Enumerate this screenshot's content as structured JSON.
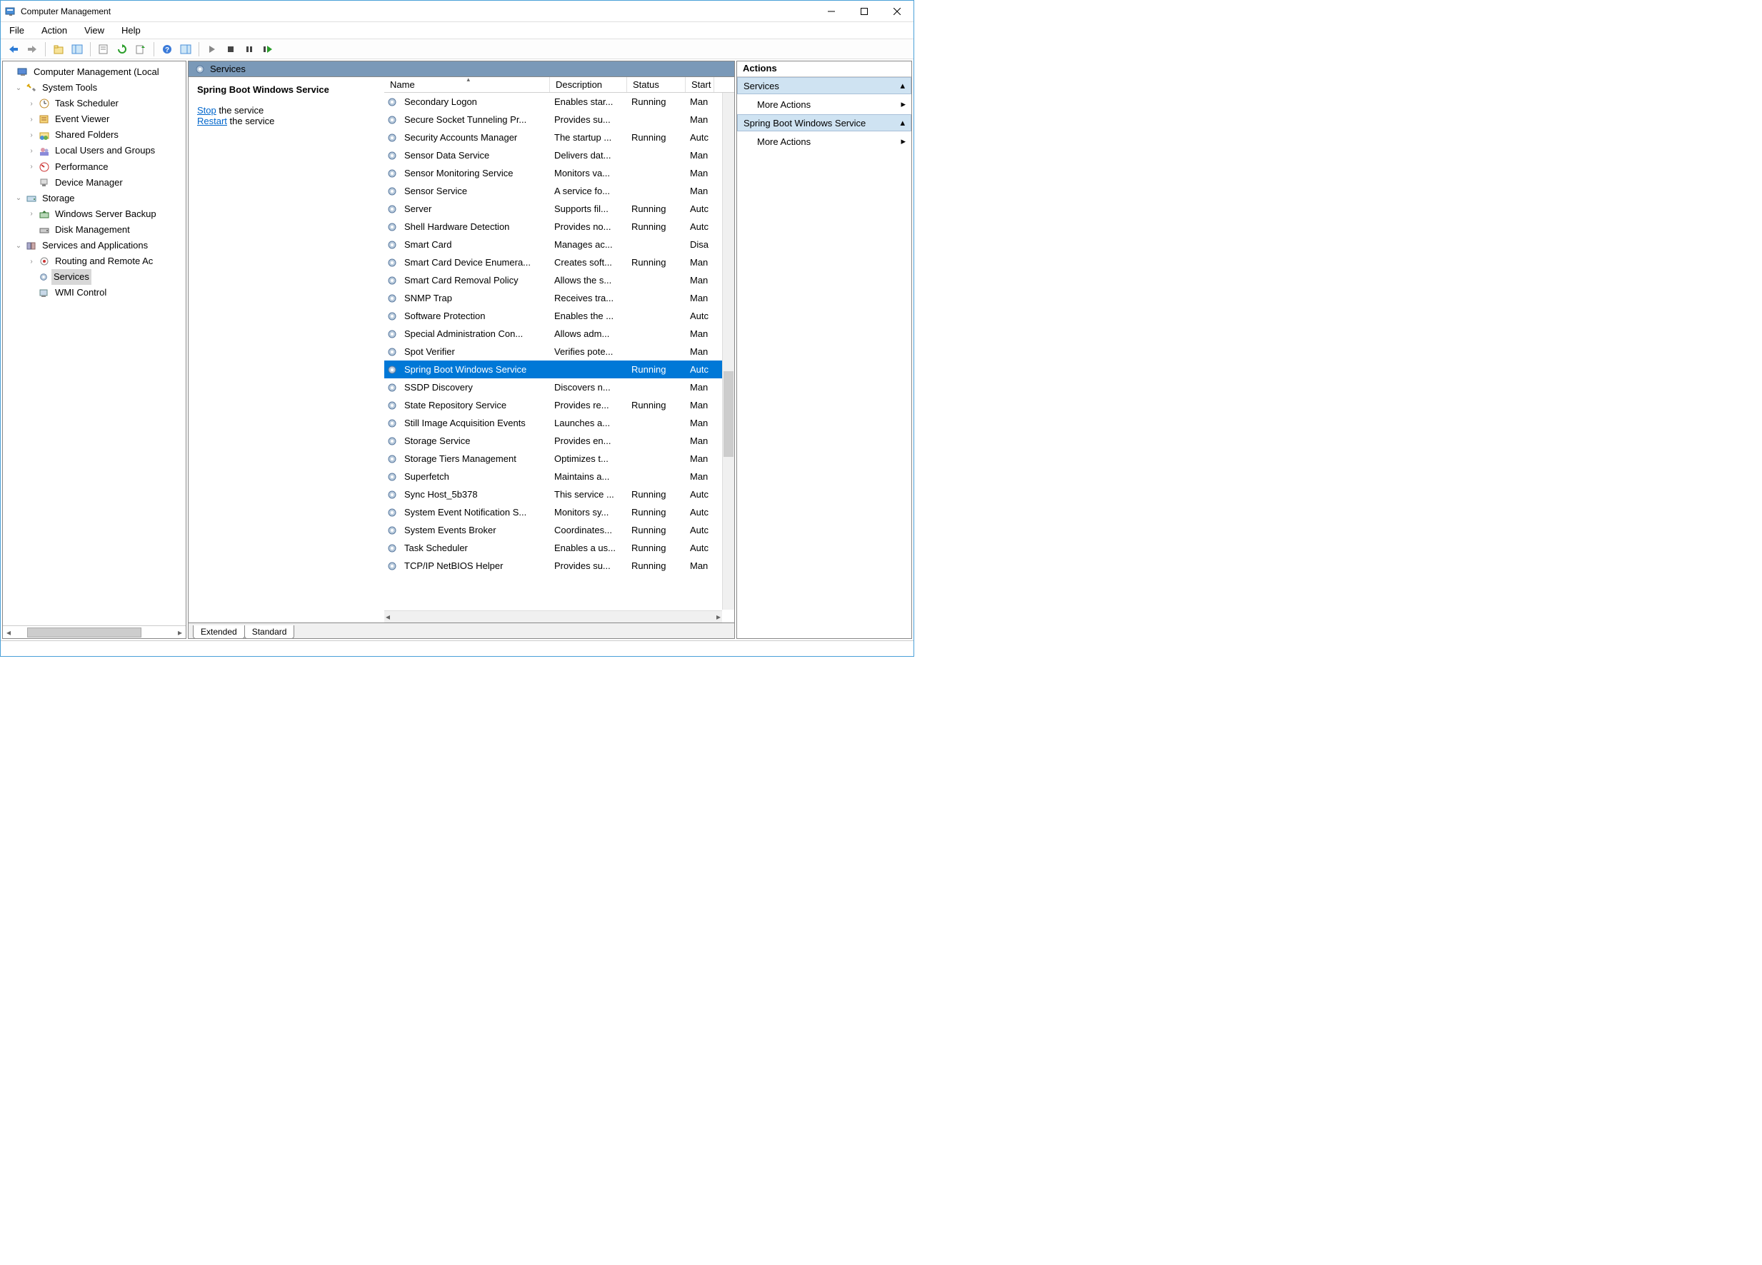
{
  "window": {
    "title": "Computer Management"
  },
  "menus": {
    "file": "File",
    "action": "Action",
    "view": "View",
    "help": "Help"
  },
  "tree": {
    "root": "Computer Management (Local",
    "systemTools": "System Tools",
    "taskScheduler": "Task Scheduler",
    "eventViewer": "Event Viewer",
    "sharedFolders": "Shared Folders",
    "localUsers": "Local Users and Groups",
    "performance": "Performance",
    "deviceManager": "Device Manager",
    "storage": "Storage",
    "wsb": "Windows Server Backup",
    "diskMgmt": "Disk Management",
    "servicesApps": "Services and Applications",
    "rras": "Routing and Remote Ac",
    "services": "Services",
    "wmi": "WMI Control"
  },
  "servicesHeader": "Services",
  "selectedService": "Spring Boot Windows Service",
  "controls": {
    "stop": "Stop",
    "restart": "Restart",
    "theService": " the service"
  },
  "columns": {
    "name": "Name",
    "desc": "Description",
    "status": "Status",
    "startup": "Start"
  },
  "tabs": {
    "extended": "Extended",
    "standard": "Standard"
  },
  "actions": {
    "header": "Actions",
    "services": "Services",
    "more": "More Actions",
    "selected": "Spring Boot Windows Service"
  },
  "rows": [
    {
      "name": "Secondary Logon",
      "desc": "Enables star...",
      "status": "Running",
      "start": "Man"
    },
    {
      "name": "Secure Socket Tunneling Pr...",
      "desc": "Provides su...",
      "status": "",
      "start": "Man"
    },
    {
      "name": "Security Accounts Manager",
      "desc": "The startup ...",
      "status": "Running",
      "start": "Autc"
    },
    {
      "name": "Sensor Data Service",
      "desc": "Delivers dat...",
      "status": "",
      "start": "Man"
    },
    {
      "name": "Sensor Monitoring Service",
      "desc": "Monitors va...",
      "status": "",
      "start": "Man"
    },
    {
      "name": "Sensor Service",
      "desc": "A service fo...",
      "status": "",
      "start": "Man"
    },
    {
      "name": "Server",
      "desc": "Supports fil...",
      "status": "Running",
      "start": "Autc"
    },
    {
      "name": "Shell Hardware Detection",
      "desc": "Provides no...",
      "status": "Running",
      "start": "Autc"
    },
    {
      "name": "Smart Card",
      "desc": "Manages ac...",
      "status": "",
      "start": "Disa"
    },
    {
      "name": "Smart Card Device Enumera...",
      "desc": "Creates soft...",
      "status": "Running",
      "start": "Man"
    },
    {
      "name": "Smart Card Removal Policy",
      "desc": "Allows the s...",
      "status": "",
      "start": "Man"
    },
    {
      "name": "SNMP Trap",
      "desc": "Receives tra...",
      "status": "",
      "start": "Man"
    },
    {
      "name": "Software Protection",
      "desc": "Enables the ...",
      "status": "",
      "start": "Autc"
    },
    {
      "name": "Special Administration Con...",
      "desc": "Allows adm...",
      "status": "",
      "start": "Man"
    },
    {
      "name": "Spot Verifier",
      "desc": "Verifies pote...",
      "status": "",
      "start": "Man"
    },
    {
      "name": "Spring Boot Windows Service",
      "desc": "",
      "status": "Running",
      "start": "Autc",
      "selected": true
    },
    {
      "name": "SSDP Discovery",
      "desc": "Discovers n...",
      "status": "",
      "start": "Man"
    },
    {
      "name": "State Repository Service",
      "desc": "Provides re...",
      "status": "Running",
      "start": "Man"
    },
    {
      "name": "Still Image Acquisition Events",
      "desc": "Launches a...",
      "status": "",
      "start": "Man"
    },
    {
      "name": "Storage Service",
      "desc": "Provides en...",
      "status": "",
      "start": "Man"
    },
    {
      "name": "Storage Tiers Management",
      "desc": "Optimizes t...",
      "status": "",
      "start": "Man"
    },
    {
      "name": "Superfetch",
      "desc": "Maintains a...",
      "status": "",
      "start": "Man"
    },
    {
      "name": "Sync Host_5b378",
      "desc": "This service ...",
      "status": "Running",
      "start": "Autc"
    },
    {
      "name": "System Event Notification S...",
      "desc": "Monitors sy...",
      "status": "Running",
      "start": "Autc"
    },
    {
      "name": "System Events Broker",
      "desc": "Coordinates...",
      "status": "Running",
      "start": "Autc"
    },
    {
      "name": "Task Scheduler",
      "desc": "Enables a us...",
      "status": "Running",
      "start": "Autc"
    },
    {
      "name": "TCP/IP NetBIOS Helper",
      "desc": "Provides su...",
      "status": "Running",
      "start": "Man"
    }
  ]
}
